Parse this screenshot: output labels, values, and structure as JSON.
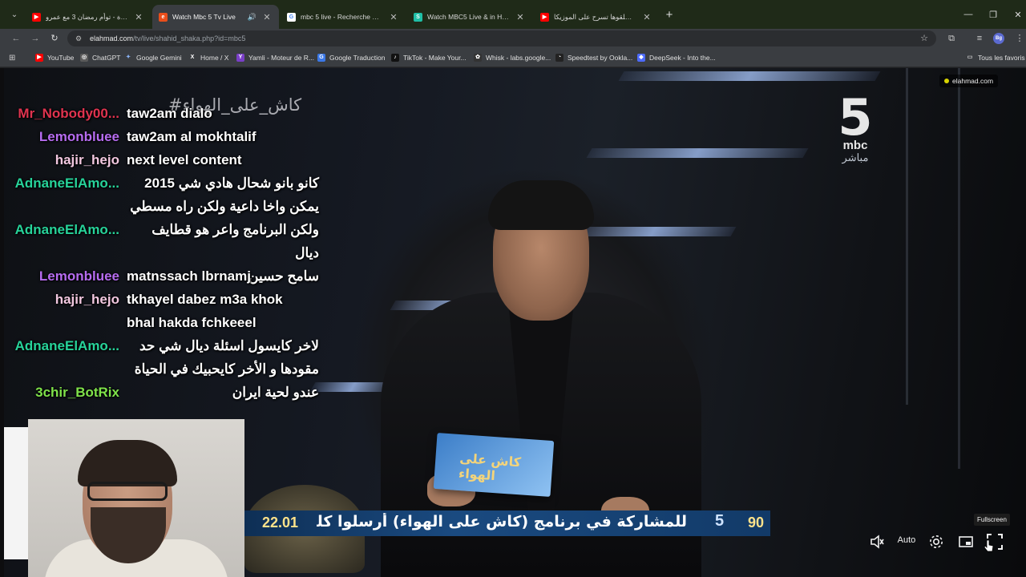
{
  "browser": {
    "tabs": [
      {
        "title": "الصلاة - توأم رمضان 3 مع عمرو",
        "favicon": "youtube-icon",
        "color": "#ff0000",
        "active": false
      },
      {
        "title": "Watch Mbc 5 Tv Live",
        "favicon": "elahmad-icon",
        "color": "#e94e1b",
        "active": true
      },
      {
        "title": "mbc 5 live - Recherche Google",
        "favicon": "google-icon",
        "color": "#4285f4",
        "active": false
      },
      {
        "title": "Watch MBC5 Live & in HD | Sha",
        "favicon": "shahid-icon",
        "color": "#1fbfa6",
        "active": false
      },
      {
        "title": "آجي نظلقوها تسرح على الموزيكا",
        "favicon": "youtube-icon",
        "color": "#ff0000",
        "active": false
      }
    ],
    "url_host": "elahmad.com",
    "url_path": "/tv/live/shahid_shaka.php?id=mbc5",
    "profile_initials": "Bg",
    "bookmarks": [
      {
        "label": "YouTube",
        "color": "#ff0000",
        "glyph": "▶"
      },
      {
        "label": "ChatGPT",
        "color": "#5a5a5a",
        "glyph": "◎"
      },
      {
        "label": "Google Gemini",
        "color": "#4a7bd0",
        "glyph": "✦"
      },
      {
        "label": "Home / X",
        "color": "#000000",
        "glyph": "X"
      },
      {
        "label": "Yamli - Moteur de R...",
        "color": "#7a3fc8",
        "glyph": "Y"
      },
      {
        "label": "Google Traduction",
        "color": "#3b78e7",
        "glyph": "G"
      },
      {
        "label": "TikTok - Make Your...",
        "color": "#111111",
        "glyph": "♪"
      },
      {
        "label": "Whisk - labs.google...",
        "color": "#333333",
        "glyph": "✿"
      },
      {
        "label": "Speedtest by Ookla...",
        "color": "#222222",
        "glyph": "◔"
      },
      {
        "label": "DeepSeek - Into the...",
        "color": "#4d6bfe",
        "glyph": "◆"
      }
    ],
    "all_bookmarks_label": "Tous les favoris"
  },
  "stream": {
    "site_badge": "elahmad.com",
    "hashtag": "#كاش_على_الهواء",
    "channel_number": "5",
    "channel_brand": "mbc",
    "channel_sub": "مباشر",
    "card_title": "كاش على الهواء",
    "ticker": {
      "time": "22.01",
      "message": "للمشاركة في برنامج (كاش على الهواء) أرسلوا كلمة (كاش) في",
      "channel_mark": "5",
      "code": "90"
    }
  },
  "chat": [
    {
      "user": "Mr_Nobody00...",
      "color": "#e0334f",
      "lines": [
        "taw2am dialo"
      ]
    },
    {
      "user": "Lemonbluee",
      "color": "#b66cf0",
      "lines": [
        "taw2am al mokhtalif"
      ]
    },
    {
      "user": "hajir_hejo",
      "color": "#f2c8e0",
      "lines": [
        "next level content"
      ]
    },
    {
      "user": "AdnaneElAmo...",
      "color": "#27d39a",
      "lines": [
        "كانو بانو شحال هادي شي 2015",
        "يمكن واخا داعية ولكن راه مسطي"
      ]
    },
    {
      "user": "AdnaneElAmo...",
      "color": "#27d39a",
      "lines": [
        "ولكن البرنامج واعر هو قطايف ديال",
        "سامح حسين"
      ]
    },
    {
      "user": "Lemonbluee",
      "color": "#b66cf0",
      "lines": [
        "matnssach lbrnamj"
      ]
    },
    {
      "user": "hajir_hejo",
      "color": "#f2c8e0",
      "lines": [
        "tkhayel dabez m3a khok",
        "bhal hakda fchkeeel"
      ]
    },
    {
      "user": "AdnaneElAmo...",
      "color": "#27d39a",
      "lines": [
        "لاخر كايسول اسئلة ديال شي حد",
        "مقودها و الأخر كايحبيك في الحياة"
      ]
    },
    {
      "user": "3chir_BotRix",
      "color": "#7fe24a",
      "lines": [
        "عندو لحية ايران"
      ]
    }
  ],
  "player": {
    "quality_label": "Auto",
    "tooltip": "Fullscreen"
  }
}
